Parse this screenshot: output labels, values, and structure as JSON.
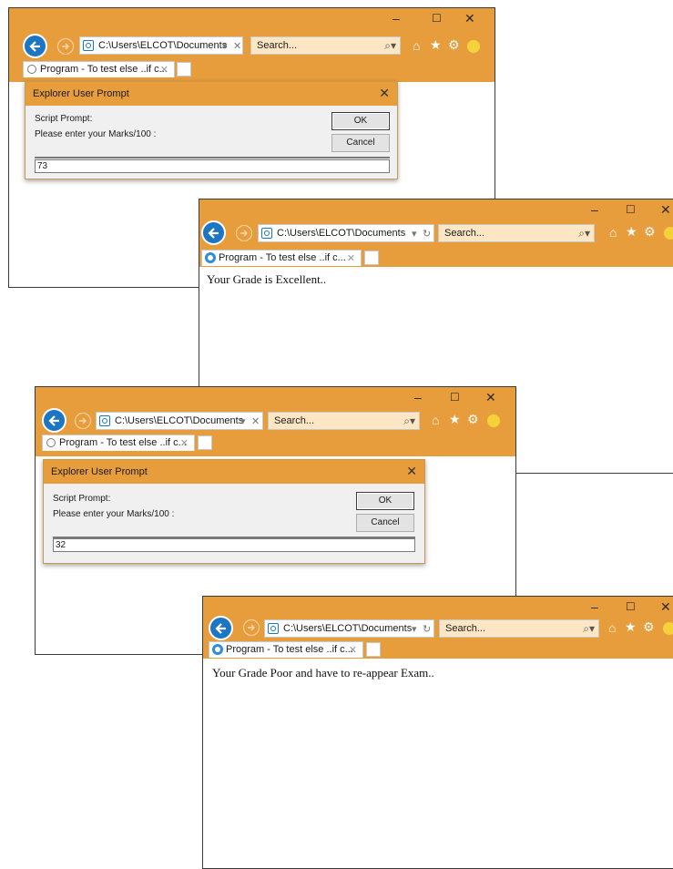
{
  "browser": {
    "address": "C:\\Users\\ELCOT\\Documents",
    "address_dropdown": "▾",
    "refresh": "↻",
    "search_placeholder": "Search...",
    "search_dropdown": "▾",
    "tab_title": "Program - To test else ..if c...",
    "tab_close": "✕",
    "minimize": "–",
    "maximize": "☐",
    "close": "✕",
    "icons": [
      "back-icon",
      "forward-icon",
      "home-icon",
      "favorites-star-icon",
      "settings-gear-icon",
      "feedback-smiley-icon",
      "search-icon",
      "ie-logo-icon",
      "new-tab-icon"
    ],
    "accent_color": "#e79d3c",
    "back_button_color": "#1c76c4"
  },
  "dialog": {
    "title": "Explorer User Prompt",
    "close": "✕",
    "script_prompt_label": "Script Prompt:",
    "message": "Please enter your Marks/100 :",
    "ok_label": "OK",
    "cancel_label": "Cancel"
  },
  "windows": [
    {
      "id": "w1",
      "input_value": "73"
    },
    {
      "id": "w2",
      "result_text": "Your Grade is Excellent.."
    },
    {
      "id": "w3",
      "input_value": "32"
    },
    {
      "id": "w4",
      "result_text": "Your Grade Poor and have to re-appear Exam.."
    }
  ]
}
